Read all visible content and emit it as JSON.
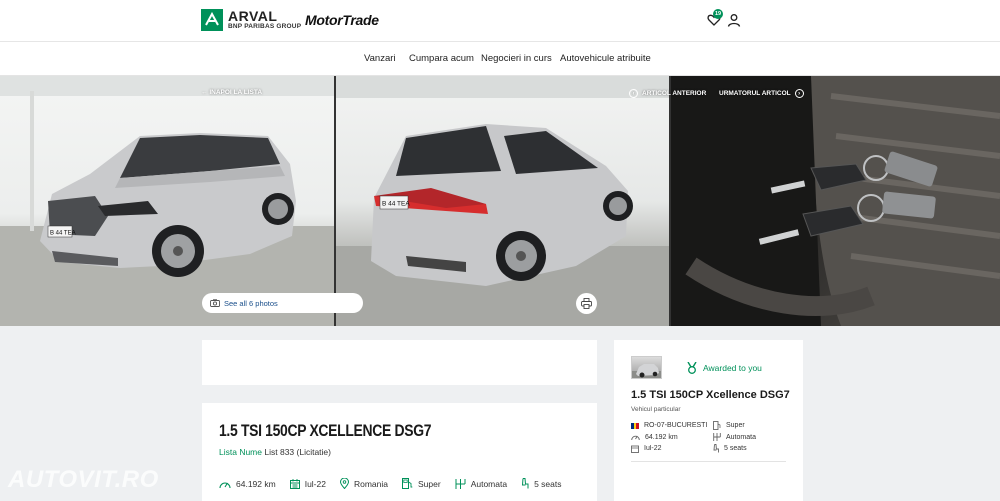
{
  "header": {
    "arval_name": "ARVAL",
    "arval_group": "BNP PARIBAS GROUP",
    "partner_name": "MotorTrade",
    "favorites_count": "19"
  },
  "nav": {
    "items": [
      {
        "label": "Vanzari"
      },
      {
        "label": "Cumpara acum"
      },
      {
        "label": "Negocieri in curs"
      },
      {
        "label": "Autovehicule atribuite"
      }
    ]
  },
  "gallery": {
    "back_label": "INAPOI LA LISTA",
    "prev_label": "ARTICOL ANTERIOR",
    "next_label": "URMATORUL ARTICOL",
    "see_all_label": "See all 6 photos",
    "plate_front": "B 44 TEA",
    "plate_rear": "B 44 TEA"
  },
  "main_card": {
    "title": "1.5 TSI 150CP XCELLENCE DSG7",
    "list_label": "Lista Nume",
    "list_value": "List 833 (Licitatie)",
    "specs": [
      {
        "icon": "odometer-icon",
        "value": "64.192 km"
      },
      {
        "icon": "calendar-icon",
        "value": "Iul-22"
      },
      {
        "icon": "location-pin-icon",
        "value": "Romania"
      },
      {
        "icon": "fuel-pump-icon",
        "value": "Super"
      },
      {
        "icon": "gearbox-icon",
        "value": "Automata"
      },
      {
        "icon": "seat-icon",
        "value": "5 seats"
      }
    ]
  },
  "side_card": {
    "awarded_label": "Awarded to you",
    "title": "1.5 TSI 150CP Xcellence DSG7",
    "subtitle": "Vehicul particular",
    "location": "RO-07-BUCURESTI",
    "fuel": "Super",
    "mileage": "64.192 km",
    "transmission": "Automata",
    "date": "Iul-22",
    "seats": "5 seats"
  },
  "watermark": "AUTOVIT.RO",
  "colors": {
    "brand_green": "#00915a",
    "link_blue": "#1a4f8b",
    "background": "#eef0f2"
  }
}
